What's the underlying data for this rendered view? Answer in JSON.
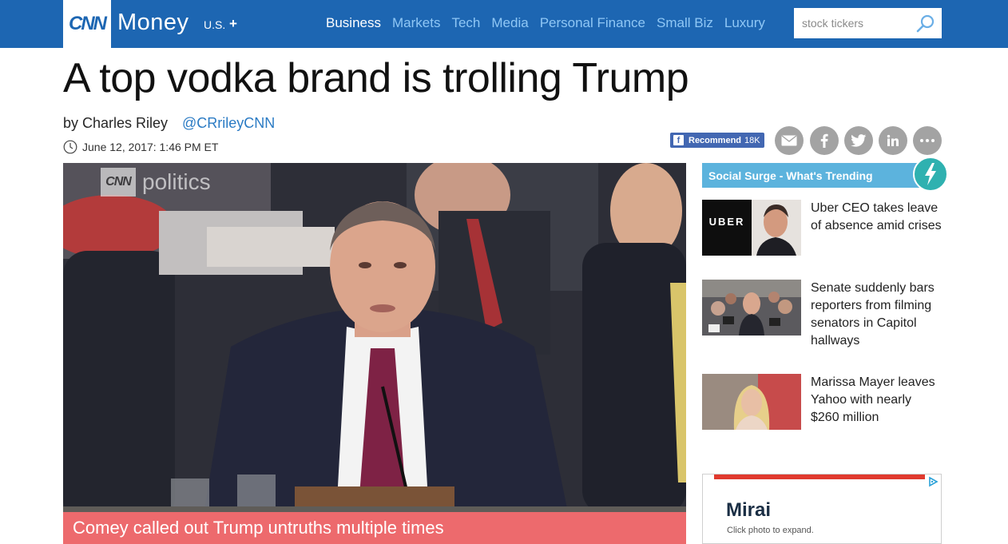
{
  "header": {
    "logo": "CNN",
    "brand": "Money",
    "edition": "U.S.",
    "edition_toggle": "+",
    "nav": [
      "Business",
      "Markets",
      "Tech",
      "Media",
      "Personal Finance",
      "Small Biz",
      "Luxury"
    ],
    "active_nav": "Business",
    "search_placeholder": "stock tickers",
    "search_icon": "search-icon",
    "color": "#1d66b2"
  },
  "article": {
    "headline": "A top vodka brand is trolling Trump",
    "byline": "by Charles Riley",
    "author_handle": "@CRrileyCNN",
    "date": "June 12, 2017: 1:46 PM ET",
    "recommend_label": "Recommend",
    "recommend_count": "18K",
    "share_icons": [
      "email-icon",
      "facebook-icon",
      "twitter-icon",
      "linkedin-icon",
      "more-icon"
    ]
  },
  "video": {
    "watermark_logo": "CNN",
    "watermark_text": "politics",
    "caption": "Comey called out Trump untruths multiple times",
    "caption_color": "#ed6a6d"
  },
  "sidebar": {
    "heading": "Social Surge - What's Trending",
    "heading_color": "#5cb3dd",
    "stories": [
      {
        "title": "Uber CEO takes leave of absence amid crises",
        "thumb_text": "UBER"
      },
      {
        "title": "Senate suddenly bars reporters from filming senators in Capitol hallways"
      },
      {
        "title": "Marissa Mayer leaves Yahoo with nearly $260 million"
      }
    ]
  },
  "ad": {
    "title": "Mirai",
    "subtitle": "Click photo to expand."
  }
}
